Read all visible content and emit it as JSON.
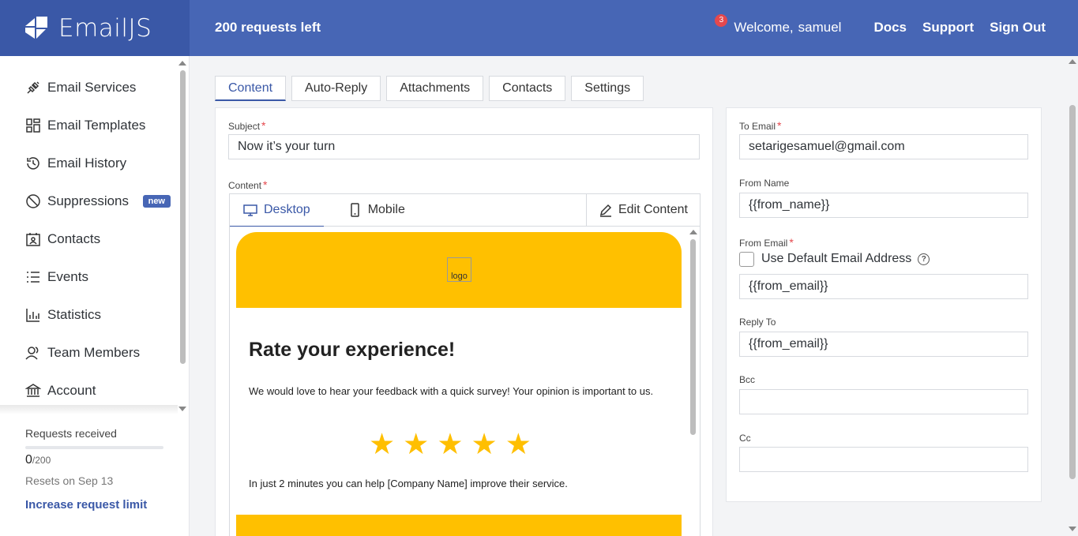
{
  "header": {
    "brand": "EmailJS",
    "requests_left": "200 requests left",
    "notification_count": "3",
    "welcome": "Welcome,",
    "username": "samuel",
    "links": [
      "Docs",
      "Support",
      "Sign Out"
    ]
  },
  "sidebar": {
    "items": [
      {
        "label": "Email Services",
        "icon": "plug-icon"
      },
      {
        "label": "Email Templates",
        "icon": "templates-icon"
      },
      {
        "label": "Email History",
        "icon": "history-icon"
      },
      {
        "label": "Suppressions",
        "icon": "block-icon",
        "badge": "new"
      },
      {
        "label": "Contacts",
        "icon": "contacts-icon"
      },
      {
        "label": "Events",
        "icon": "list-icon"
      },
      {
        "label": "Statistics",
        "icon": "chart-icon"
      },
      {
        "label": "Team Members",
        "icon": "team-icon"
      },
      {
        "label": "Account",
        "icon": "bank-icon"
      }
    ],
    "usage": {
      "label": "Requests received",
      "count": "0",
      "limit": "/200",
      "fraction_used": 0,
      "resets": "Resets on Sep 13",
      "increase_link": "Increase request limit"
    }
  },
  "tabs": [
    "Content",
    "Auto-Reply",
    "Attachments",
    "Contacts",
    "Settings"
  ],
  "active_tab": "Content",
  "left_panel": {
    "subject_label": "Subject",
    "subject_value": "Now it’s your turn",
    "content_label": "Content",
    "editor_tabs": {
      "desktop": "Desktop",
      "mobile": "Mobile",
      "edit": "Edit Content"
    },
    "preview": {
      "logo_alt": "logo",
      "title": "Rate your experience!",
      "text": "We would love to hear your feedback with a quick survey! Your opinion is important to us.",
      "stars": 5,
      "text2": "In just 2 minutes you can help [Company Name] improve their service."
    }
  },
  "right_panel": {
    "to_email_label": "To Email",
    "to_email_value": "setarigesamuel@gmail.com",
    "from_name_label": "From Name",
    "from_name_value": "{{from_name}}",
    "from_email_label": "From Email",
    "use_default_label": "Use Default Email Address",
    "use_default_checked": false,
    "from_email_value": "{{from_email}}",
    "reply_to_label": "Reply To",
    "reply_to_value": "{{from_email}}",
    "bcc_label": "Bcc",
    "bcc_value": "",
    "cc_label": "Cc",
    "cc_value": ""
  },
  "colors": {
    "header_bg": "#4766b5",
    "logo_bg": "#3a58a7",
    "accent": "#3a58a7",
    "required": "#e5484d",
    "preview_yellow": "#ffc000",
    "star": "#ffbf00"
  }
}
